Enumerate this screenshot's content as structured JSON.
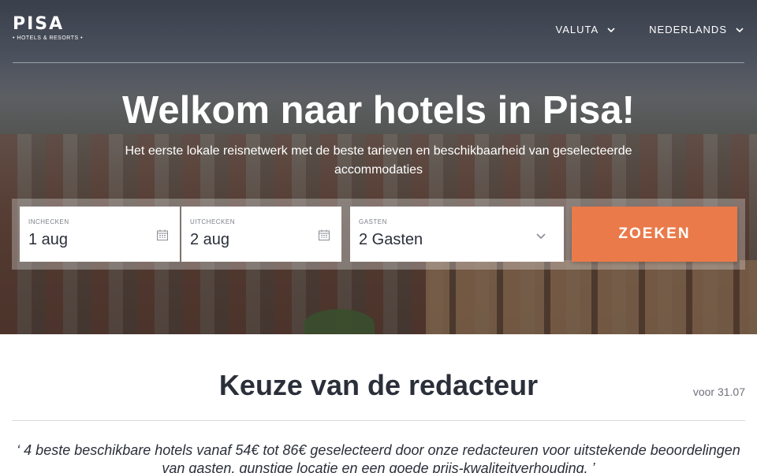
{
  "brand": {
    "name": "PISA",
    "tagline": "• HOTELS & RESORTS •"
  },
  "nav": {
    "currency": {
      "label": "VALUTA",
      "icon": "chevron-down-icon"
    },
    "language": {
      "label": "NEDERLANDS",
      "icon": "chevron-down-icon"
    }
  },
  "hero": {
    "title": "Welkom naar hotels in Pisa!",
    "subtitle": "Het eerste lokale reisnetwerk met de beste tarieven en beschikbaarheid van geselecteerde accommodaties"
  },
  "search": {
    "checkin": {
      "label": "INCHECKEN",
      "value": "1 aug",
      "icon": "calendar-icon"
    },
    "checkout": {
      "label": "UITCHECKEN",
      "value": "2 aug",
      "icon": "calendar-icon"
    },
    "guests": {
      "label": "GASTEN",
      "value": "2 Gasten",
      "icon": "chevron-down-icon"
    },
    "button_label": "ZOEKEN"
  },
  "editors_choice": {
    "title": "Keuze van de redacteur",
    "date": "voor 31.07",
    "quote": "‘ 4 beste beschikbare hotels vanaf 54€ tot 86€ geselecteerd door onze redacteuren voor uitstekende beoordelingen van gasten, gunstige locatie en een goede prijs-kwaliteitverhouding. ’"
  },
  "colors": {
    "accent": "#ea7a4a",
    "text": "#2b2f3a"
  }
}
